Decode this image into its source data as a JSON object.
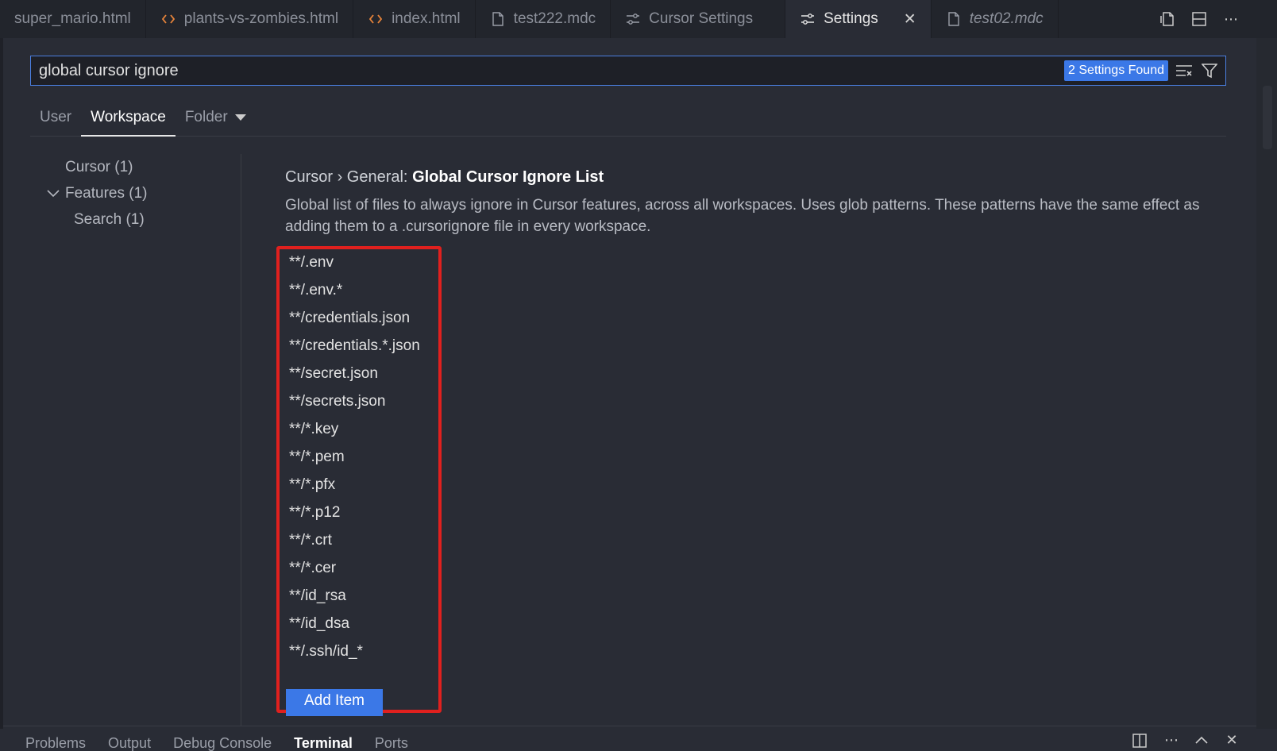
{
  "tabs": [
    {
      "label": "super_mario.html",
      "icon": "none"
    },
    {
      "label": "plants-vs-zombies.html",
      "icon": "code-icon"
    },
    {
      "label": "index.html",
      "icon": "code-icon"
    },
    {
      "label": "test222.mdc",
      "icon": "file-icon"
    },
    {
      "label": "Cursor Settings",
      "icon": "settings-sliders-icon"
    },
    {
      "label": "Settings",
      "icon": "settings-sliders-icon",
      "close": "✕"
    },
    {
      "label": "test02.mdc",
      "icon": "file-icon"
    }
  ],
  "tab_actions": [
    "open-file-icon",
    "split-editor-icon",
    "more-icon"
  ],
  "search": {
    "value": "global cursor ignore",
    "found_label": "2 Settings Found"
  },
  "scope_tabs": {
    "user": "User",
    "workspace": "Workspace",
    "folder": "Folder"
  },
  "toc": {
    "cursor": "Cursor (1)",
    "features": "Features (1)",
    "search": "Search (1)"
  },
  "setting": {
    "breadcrumb": "Cursor › General: ",
    "name": "Global Cursor Ignore List",
    "description": "Global list of files to always ignore in Cursor features, across all workspaces. Uses glob patterns. These patterns have the same effect as adding them to a .cursorignore file in every workspace.",
    "items": [
      "**/.env",
      "**/.env.*",
      "**/credentials.json",
      "**/credentials.*.json",
      "**/secret.json",
      "**/secrets.json",
      "**/*.key",
      "**/*.pem",
      "**/*.pfx",
      "**/*.p12",
      "**/*.crt",
      "**/*.cer",
      "**/id_rsa",
      "**/id_dsa",
      "**/.ssh/id_*"
    ],
    "add_button": "Add Item"
  },
  "panel": {
    "tabs": [
      "Problems",
      "Output",
      "Debug Console",
      "Terminal",
      "Ports"
    ],
    "active": "Terminal"
  },
  "colors": {
    "accent": "#3b78e7",
    "highlight_box": "#e0201e",
    "background": "#292c35"
  }
}
